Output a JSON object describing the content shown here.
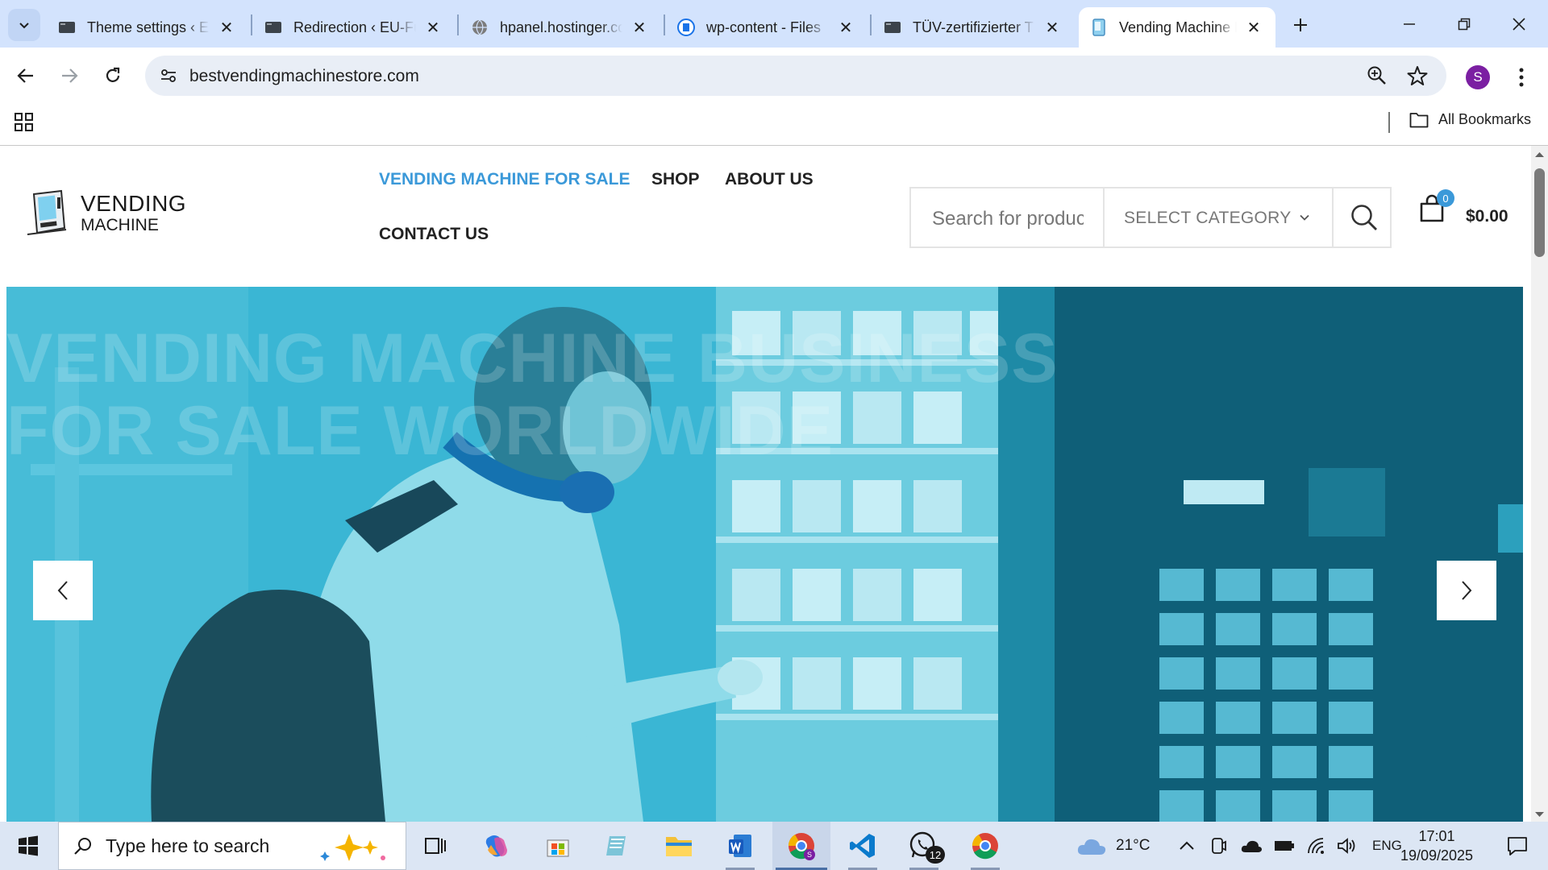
{
  "browser": {
    "tabs": [
      {
        "title": "Theme settings ‹ El",
        "active": false
      },
      {
        "title": "Redirection ‹ EU-Fu",
        "active": false
      },
      {
        "title": "hpanel.hostinger.co",
        "active": false
      },
      {
        "title": "wp-content - Files",
        "active": false
      },
      {
        "title": "TÜV-zertifizierter T",
        "active": false
      },
      {
        "title": "Vending Machine B",
        "active": true
      }
    ],
    "url": "bestvendingmachinestore.com",
    "profile_initial": "S",
    "all_bookmarks_label": "All Bookmarks"
  },
  "site": {
    "logo": {
      "line1": "VENDING",
      "line2": "MACHINE"
    },
    "nav": [
      {
        "label": "VENDING MACHINE FOR SALE",
        "active": true
      },
      {
        "label": "SHOP",
        "active": false
      },
      {
        "label": "ABOUT US",
        "active": false
      },
      {
        "label": "CONTACT US",
        "active": false
      }
    ],
    "search": {
      "placeholder": "Search for products",
      "category_label": "SELECT CATEGORY"
    },
    "cart": {
      "count": "0",
      "total": "$0.00"
    },
    "hero": {
      "title_line1": "VENDING MACHINE BUSINESS",
      "title_line2": "FOR SALE WORLDWIDE"
    },
    "colors": {
      "accent": "#3b99d9",
      "hero_tint": "#39b5d3"
    }
  },
  "taskbar": {
    "search_placeholder": "Type here to search",
    "whatsapp_badge": "12",
    "weather": "21°C",
    "language": "ENG",
    "time": "17:01",
    "date": "19/09/2025"
  }
}
